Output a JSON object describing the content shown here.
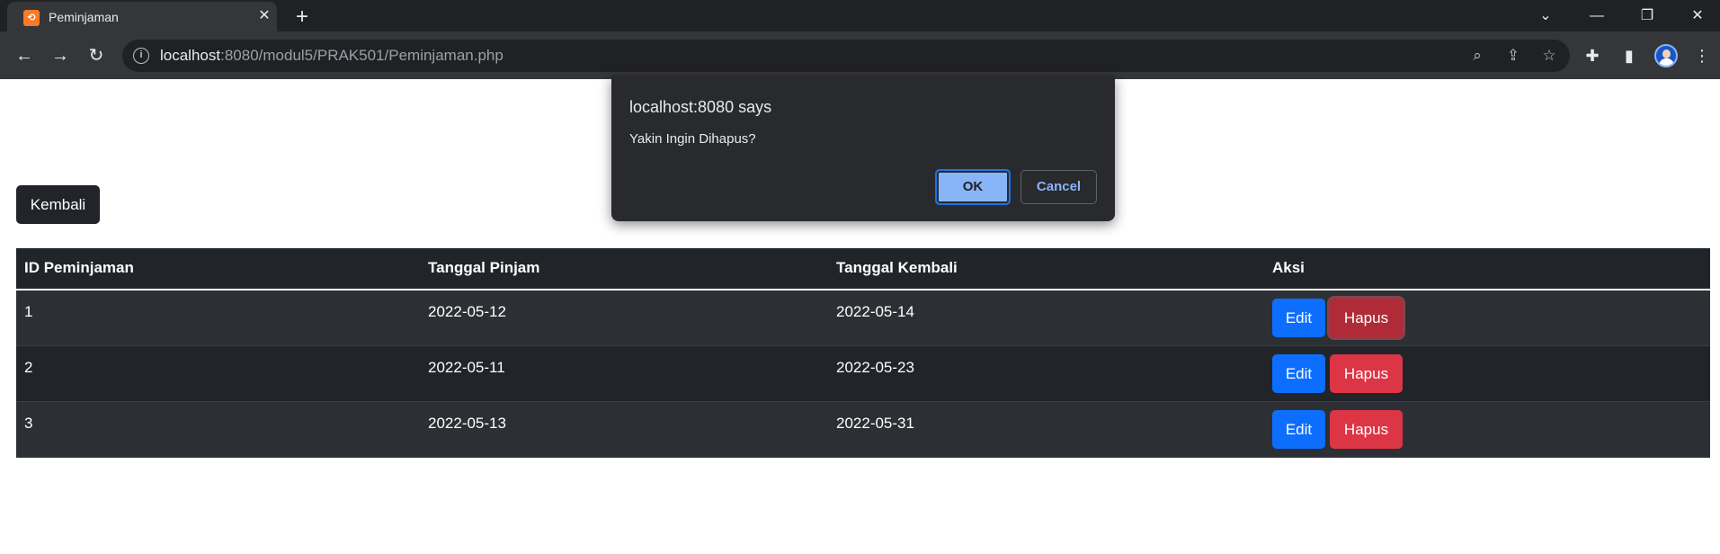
{
  "browser": {
    "tab": {
      "title": "Peminjaman",
      "favicon_glyph": "⟲",
      "favicon_color": "#fb7a24"
    },
    "url": {
      "host": "localhost",
      "rest": ":8080/modul5/PRAK501/Peminjaman.php"
    },
    "icons": {
      "back": "←",
      "forward": "→",
      "reload": "↻",
      "new_tab": "+",
      "close_tab": "✕",
      "chevron_down": "⌄",
      "minimize": "—",
      "restore": "❐",
      "close_window": "✕",
      "info": "i",
      "zoom": "⌕",
      "share": "⇪",
      "bookmark": "☆",
      "extensions": "✚",
      "side_panel": "▮",
      "menu": "⋮"
    }
  },
  "page": {
    "back_button_label": "Kembali",
    "table": {
      "headers": [
        "ID Peminjaman",
        "Tanggal Pinjam",
        "Tanggal Kembali",
        "Aksi"
      ],
      "rows": [
        {
          "id": "1",
          "tanggal_pinjam": "2022-05-12",
          "tanggal_kembali": "2022-05-14",
          "edit_label": "Edit",
          "delete_label": "Hapus"
        },
        {
          "id": "2",
          "tanggal_pinjam": "2022-05-11",
          "tanggal_kembali": "2022-05-23",
          "edit_label": "Edit",
          "delete_label": "Hapus"
        },
        {
          "id": "3",
          "tanggal_pinjam": "2022-05-13",
          "tanggal_kembali": "2022-05-31",
          "edit_label": "Edit",
          "delete_label": "Hapus"
        }
      ]
    }
  },
  "dialog": {
    "title": "localhost:8080 says",
    "message": "Yakin Ingin Dihapus?",
    "ok_label": "OK",
    "cancel_label": "Cancel"
  },
  "colors": {
    "primary": "#0d6efd",
    "danger": "#dc3545",
    "dark": "#212529",
    "dialog_accent": "#8ab4f8"
  }
}
